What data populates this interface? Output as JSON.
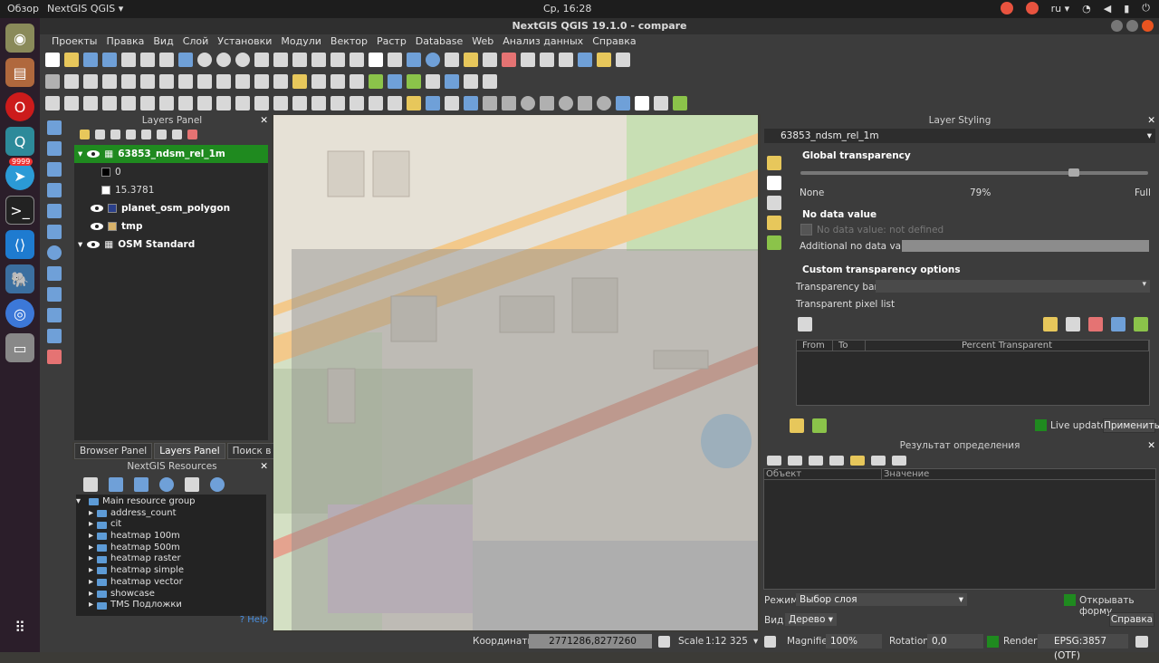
{
  "topbar": {
    "overview": "Обзор",
    "app": "NextGIS QGIS ▾",
    "clock": "Ср, 16:28",
    "lang": "ru ▾"
  },
  "launcher": {
    "telegram_badge": "9999"
  },
  "window": {
    "title": "NextGIS QGIS 19.1.0 - compare"
  },
  "menu": [
    "Проекты",
    "Правка",
    "Вид",
    "Слой",
    "Установки",
    "Модули",
    "Вектор",
    "Растр",
    "Database",
    "Web",
    "Анализ данных",
    "Справка"
  ],
  "layers_panel": {
    "title": "Layers Panel",
    "close": "✕",
    "layers": [
      {
        "name": "63853_ndsm_rel_1m",
        "selected": true,
        "legend": [
          {
            "label": "0",
            "color": "#000000"
          },
          {
            "label": "15.3781",
            "color": "#ffffff"
          }
        ]
      },
      {
        "name": "planet_osm_polygon",
        "swatch": "#2a3f8a"
      },
      {
        "name": "tmp",
        "swatch": "#d9b36a"
      },
      {
        "name": "OSM Standard"
      }
    ]
  },
  "bottom_tabs": [
    "Browser Panel",
    "Layers Panel",
    "Поиск в QMS"
  ],
  "ngw": {
    "title": "NextGIS Resources",
    "root": "Main resource group",
    "items": [
      "address_count",
      "cit",
      "heatmap 100m",
      "heatmap 500m",
      "heatmap raster",
      "heatmap simple",
      "heatmap vector",
      "showcase",
      "TMS Подложки"
    ],
    "help": "? Help"
  },
  "styling": {
    "title": "Layer Styling",
    "layer": "63853_ndsm_rel_1m",
    "global_transparency": "Global transparency",
    "none": "None",
    "percent": "79%",
    "full": "Full",
    "transparency_value": 0.79,
    "no_data_value": "No data value",
    "no_data_checkbox": "No data value: not defined",
    "additional_no_data": "Additional no data value",
    "custom": "Custom transparency options",
    "transparency_band": "Transparency band",
    "pixel_list": "Transparent pixel list",
    "col_from": "From",
    "col_to": "To",
    "col_percent": "Percent Transparent",
    "live_update": "Live update",
    "apply": "Применить"
  },
  "identify": {
    "title": "Результат определения",
    "col_object": "Объект",
    "col_value": "Значение",
    "mode_label": "Режим",
    "mode_value": "Выбор слоя",
    "open_form": "Открывать форму",
    "view_label": "Вид",
    "view_value": "Дерево",
    "help": "Справка"
  },
  "status": {
    "coords_label": "Координаты",
    "coords": "2771286,8277260",
    "scale_label": "Scale",
    "scale": "1:12 325",
    "magnifier_label": "Magnifier",
    "magnifier": "100%",
    "rotation_label": "Rotation",
    "rotation": "0,0",
    "render": "Render",
    "crs": "EPSG:3857 (OTF)"
  },
  "colors": {
    "accent": "#1f8a1f",
    "panel": "#3c3c3c"
  }
}
